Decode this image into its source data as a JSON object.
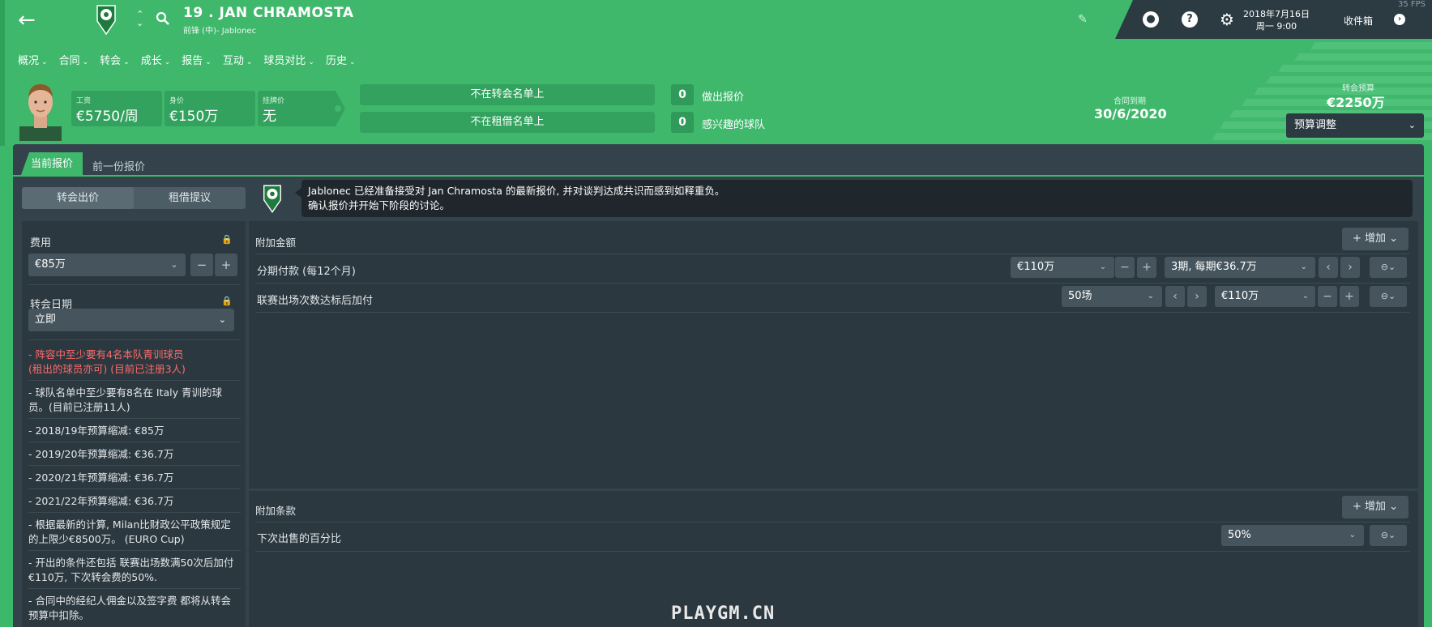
{
  "header": {
    "player_name": "19 . JAN CHRAMOSTA",
    "position": "前锋 (中)- Jablonec",
    "datetime_line1": "2018年7月16日",
    "datetime_line2": "周一 9:00",
    "inbox": "收件箱",
    "fps": "35 FPS",
    "help_icon": "?",
    "icons": [
      "back-arrow-icon",
      "club-crest-icon",
      "up-down-icon",
      "search-icon",
      "edit-icon",
      "ball-icon",
      "help-icon",
      "settings-icon",
      "chevron-right-icon"
    ]
  },
  "menu": [
    {
      "label": "概况"
    },
    {
      "label": "合同"
    },
    {
      "label": "转会"
    },
    {
      "label": "成长"
    },
    {
      "label": "报告"
    },
    {
      "label": "互动"
    },
    {
      "label": "球员对比"
    },
    {
      "label": "历史"
    }
  ],
  "stats": {
    "wage_label": "工资",
    "wage_value": "€5750/周",
    "value_label": "身价",
    "value_value": "€150万",
    "asking_label": "挂牌价",
    "asking_value": "无"
  },
  "status": {
    "transfer_list": "不在转会名单上",
    "loan_list": "不在租借名单上",
    "offers_count": "0",
    "offers_label": "做出报价",
    "interested_count": "0",
    "interested_label": "感兴趣的球队"
  },
  "contract": {
    "label": "合同到期",
    "value": "30/6/2020"
  },
  "budget": {
    "label": "转会预算",
    "value": "€2250万",
    "adjust_label": "预算调整"
  },
  "tabs": {
    "current": "当前报价",
    "previous": "前一份报价"
  },
  "offer_type": {
    "transfer": "转会出价",
    "loan": "租借提议"
  },
  "message": {
    "line1": "Jablonec 已经准备接受对 Jan Chramosta 的最新报价, 并对谈判达成共识而感到如释重负。",
    "line2": "确认报价并开始下阶段的讨论。"
  },
  "fee": {
    "label": "费用",
    "value": "€85万"
  },
  "transfer_date": {
    "label": "转会日期",
    "value": "立即"
  },
  "rules": [
    {
      "text": "- 阵容中至少要有4名本队青训球员\n(租出的球员亦可) (目前已注册3人)",
      "warning": true
    },
    {
      "text": "- 球队名单中至少要有8名在 Italy 青训的球员。(目前已注册11人)",
      "warning": false
    },
    {
      "text": "- 2018/19年预算缩减: €85万",
      "warning": false
    },
    {
      "text": "- 2019/20年预算缩减: €36.7万",
      "warning": false
    },
    {
      "text": "- 2020/21年预算缩减: €36.7万",
      "warning": false
    },
    {
      "text": "- 2021/22年预算缩减: €36.7万",
      "warning": false
    },
    {
      "text": "- 根据最新的计算, Milan比财政公平政策规定的上限少€8500万。 (EURO Cup)",
      "warning": false
    },
    {
      "text": "-  开出的条件还包括 联赛出场数满50次后加付 €110万, 下次转会费的50%.",
      "warning": false
    },
    {
      "text": "- 合同中的经纪人佣金以及签字费 都将从转会预算中扣除。",
      "warning": false
    }
  ],
  "add_on": {
    "title": "附加金额",
    "add_label": "增加",
    "installments": {
      "label": "分期付款 (每12个月)",
      "amount": "€110万",
      "periods": "3期, 每期€36.7万"
    },
    "appearances": {
      "label": "联赛出场次数达标后加付",
      "apps": "50场",
      "amount": "€110万"
    }
  },
  "clauses": {
    "title": "附加条款",
    "add_label": "增加",
    "sell_on": {
      "label": "下次出售的百分比",
      "value": "50%"
    }
  },
  "watermark": "PLAYGM.CN",
  "colors": {
    "accent": "#3fb86c",
    "panel": "#34434b",
    "warning": "#ff6b6b"
  }
}
